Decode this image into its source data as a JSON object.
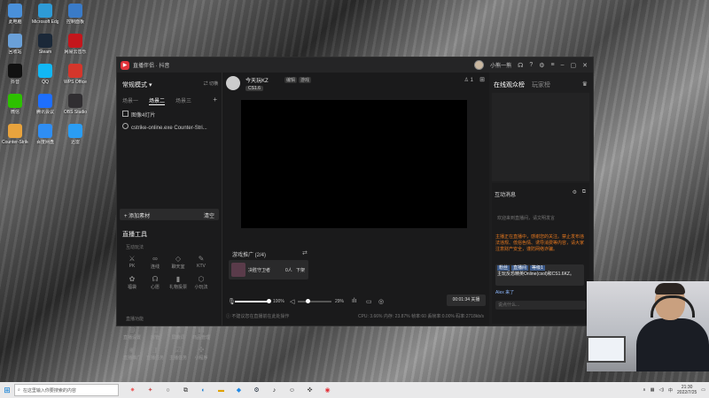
{
  "desktop": {
    "icons": [
      {
        "label": "此电脑",
        "color": "#4a90d9"
      },
      {
        "label": "Microsoft Edge",
        "color": "#2e9bd6"
      },
      {
        "label": "控制面板",
        "color": "#3a7bc8"
      },
      {
        "label": "回收站",
        "color": "#6aa0d8"
      },
      {
        "label": "Steam",
        "color": "#1b2838"
      },
      {
        "label": "网易云音乐",
        "color": "#c4161c"
      },
      {
        "label": "抖音",
        "color": "#111111"
      },
      {
        "label": "QQ",
        "color": "#12b7f5"
      },
      {
        "label": "WPS Office",
        "color": "#d4362b"
      },
      {
        "label": "微信",
        "color": "#2dc100"
      },
      {
        "label": "腾讯会议",
        "color": "#1e6fff"
      },
      {
        "label": "OBS Studio",
        "color": "#302e31"
      },
      {
        "label": "Counter-Strike",
        "color": "#e8a33d"
      },
      {
        "label": "百度网盘",
        "color": "#2f8ef3"
      },
      {
        "label": "迅雷",
        "color": "#2a9df4"
      }
    ]
  },
  "window": {
    "app_title": "直播伴侣 · 抖音",
    "user_name": "小熊一熊",
    "titlebar_icons": [
      "headset-icon",
      "help-icon",
      "settings-icon",
      "menu-icon",
      "minimize-icon",
      "maximize-icon",
      "close-icon"
    ]
  },
  "left": {
    "mode": "常规模式 ▾",
    "switch_label": "⇄ 切横",
    "scene_tabs": [
      "场景一",
      "场景二",
      "场景三"
    ],
    "scene_add": "+",
    "sources": [
      "图像4灯片",
      "cstrike-online.exe Counter-Stri..."
    ],
    "add_material": "+ 添加素材",
    "clear": "清空",
    "tools_title": "直播工具",
    "interact_title": "互动玩法",
    "interact_tools": [
      {
        "icon": "⚔",
        "label": "PK"
      },
      {
        "icon": "∞",
        "label": "连线"
      },
      {
        "icon": "◇",
        "label": "聊天室"
      },
      {
        "icon": "✎",
        "label": "KTV"
      },
      {
        "icon": "✿",
        "label": "福袋"
      },
      {
        "icon": "☊",
        "label": "心愿"
      },
      {
        "icon": "▮",
        "label": "礼物投票"
      },
      {
        "icon": "⬡",
        "label": "小玩法"
      }
    ],
    "live_title": "直播功能",
    "live_tools": [
      {
        "icon": "◎",
        "label": "直播设置"
      },
      {
        "icon": "◫",
        "label": "房管"
      },
      {
        "icon": "▣",
        "label": "屏蔽词"
      },
      {
        "icon": "▤",
        "label": "商品管理"
      },
      {
        "icon": "◉",
        "label": "直播推广"
      },
      {
        "icon": "◨",
        "label": "直播任务"
      },
      {
        "icon": "☑",
        "label": "主播任务"
      },
      {
        "icon": "✣",
        "label": "小程序"
      }
    ]
  },
  "center": {
    "anchor_name": "今天玩KZ",
    "anchor_level": "CS1.6",
    "tags": [
      "编辑",
      "游戏"
    ],
    "viewer_count": "1",
    "promo_title": "游戏推广 (2/4)",
    "promo_card_title": "决胜守卫者",
    "promo_card_people": "0人",
    "promo_card_action": "下架",
    "mic_volume_label": "100%",
    "speaker_volume_label": "29%",
    "live_timer": "00:01:34 关播",
    "status_text": "不建议您在直播前在此处操作",
    "stats_text": "CPU: 3.66%   内存: 23.87%   帧率:60   丢帧率:0.00%   码率:2718kb/s"
  },
  "right": {
    "tabs": [
      "在线观众榜",
      "玩家榜"
    ],
    "messages_title": "互动消息",
    "system_msg": "欢迎来到直播间，请文明发言",
    "orange_msg": "主播正在直播中，感谢您的关注。禁止发布违法违规、低俗色情、诱导消费等内容，请大家注意财产安全，谨防网络诈骗。",
    "pinned_tags": [
      "粉丝",
      "直播间",
      "等级1"
    ],
    "pinned_msg": "主玩反恐精英Online(csol)和CS1.6KZ。",
    "like_msg": "Alex 来了",
    "chat_placeholder": "说点什么..."
  },
  "taskbar": {
    "search_placeholder": "在这里输入你要搜索的内容",
    "time": "21:30",
    "date": "2022/7/25",
    "lang": "中"
  }
}
